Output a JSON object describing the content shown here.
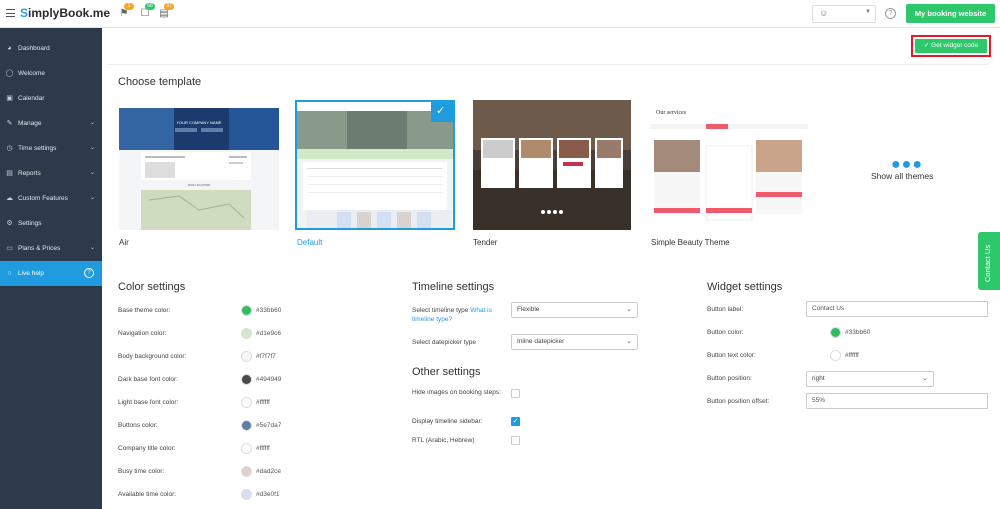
{
  "brand": {
    "name": "SimplyBook.me",
    "first_letter": "S",
    "rest": "implyBook.me"
  },
  "topbar": {
    "notifications": [
      {
        "icon": "bell-icon",
        "badge": "1",
        "badge_color": "#f5a623"
      },
      {
        "icon": "calendar-check-icon",
        "badge": "68",
        "badge_color": "#2ec76a"
      },
      {
        "icon": "calendar-list-icon",
        "badge": "37",
        "badge_color": "#f5a623"
      }
    ],
    "help_label": "?",
    "booking_button": "My booking website"
  },
  "sidebar": {
    "items": [
      {
        "label": "Dashboard",
        "icon": "dashboard-icon",
        "chevron": false
      },
      {
        "label": "Welcome",
        "icon": "bulb-icon",
        "chevron": false
      },
      {
        "label": "Calendar",
        "icon": "calendar-icon",
        "chevron": false
      },
      {
        "label": "Manage",
        "icon": "edit-icon",
        "chevron": true
      },
      {
        "label": "Time settings",
        "icon": "clock-icon",
        "chevron": true
      },
      {
        "label": "Reports",
        "icon": "chart-icon",
        "chevron": true
      },
      {
        "label": "Custom Features",
        "icon": "cloud-icon",
        "chevron": true
      },
      {
        "label": "Settings",
        "icon": "gear-icon",
        "chevron": false
      },
      {
        "label": "Plans & Prices",
        "icon": "card-icon",
        "chevron": true
      },
      {
        "label": "Live help",
        "icon": "chat-icon",
        "chevron": false
      }
    ]
  },
  "widget_button": "Get widget code",
  "choose_template": {
    "title": "Choose template",
    "templates": [
      "Air",
      "Default",
      "Tender",
      "Simple Beauty Theme"
    ],
    "selected": "Default",
    "show_all": "Show all themes",
    "air_thumb": {
      "company": "YOUR COMPANY NAME",
      "location": "OUR LOCATION"
    },
    "beauty_thumb": {
      "heading": "Our services"
    }
  },
  "color_settings": {
    "title": "Color settings",
    "rows": [
      {
        "label": "Base theme color:",
        "hex": "#33bb60",
        "color": "#33bb60"
      },
      {
        "label": "Navigation color:",
        "hex": "#d1e9c6",
        "color": "#d1e9c6"
      },
      {
        "label": "Body background color:",
        "hex": "#f7f7f7",
        "color": "#f7f7f7"
      },
      {
        "label": "Dark base font color:",
        "hex": "#494949",
        "color": "#494949"
      },
      {
        "label": "Light base font color:",
        "hex": "#ffffff",
        "color": "#ffffff"
      },
      {
        "label": "Buttons color:",
        "hex": "#5e7da7",
        "color": "#5e7da7"
      },
      {
        "label": "Company title color:",
        "hex": "#ffffff",
        "color": "#ffffff"
      },
      {
        "label": "Busy time color:",
        "hex": "#dad2ce",
        "color": "#dad2ce"
      },
      {
        "label": "Available time color:",
        "hex": "#d3e0f1",
        "color": "#d3e0f1"
      }
    ]
  },
  "timeline_settings": {
    "title": "Timeline settings",
    "type_label": "Select timeline type",
    "type_link": "What is timeline type?",
    "type_value": "Flexible",
    "datepicker_label": "Select datepicker type",
    "datepicker_value": "Inline datepicker"
  },
  "other_settings": {
    "title": "Other settings",
    "rows": [
      {
        "label": "Hide images on booking steps:",
        "checked": false
      },
      {
        "label": "Display timeline sidebar:",
        "checked": true
      },
      {
        "label": "RTL (Arabic, Hebrew)",
        "checked": false
      }
    ]
  },
  "widget_settings": {
    "title": "Widget settings",
    "button_label_label": "Button label:",
    "button_label_value": "Contact Us",
    "button_color_label": "Button color:",
    "button_color_hex": "#33bb60",
    "button_text_color_label": "Button text color:",
    "button_text_color_hex": "#ffffff",
    "button_position_label": "Button position:",
    "button_position_value": "right",
    "button_offset_label": "Button position offset:",
    "button_offset_value": "55%"
  },
  "contact_tab": "Contact Us",
  "colors": {
    "accent": "#1f9be0",
    "green": "#2ec76a",
    "sidebar": "#2c3a4c",
    "highlight": "#e21b2a"
  }
}
